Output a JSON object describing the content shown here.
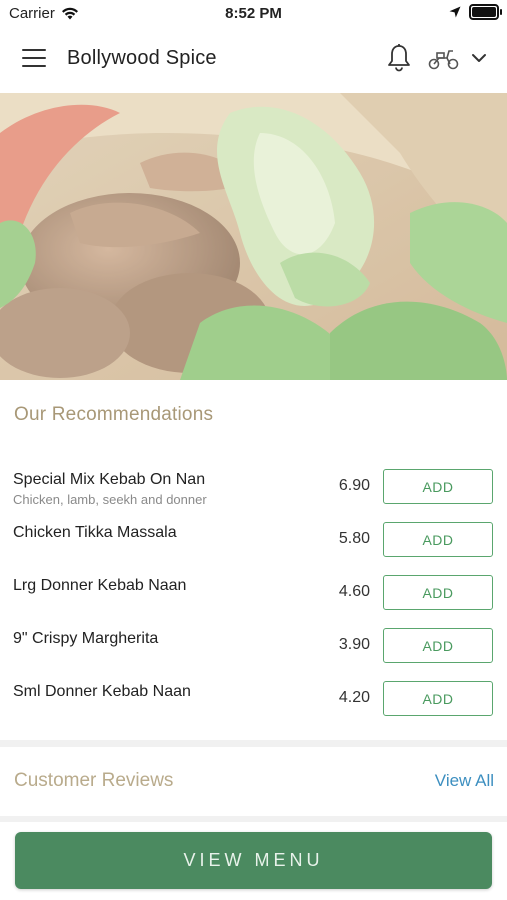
{
  "status_bar": {
    "carrier": "Carrier",
    "time": "8:52 PM"
  },
  "header": {
    "title": "Bollywood Spice"
  },
  "recommendations": {
    "title": "Our Recommendations",
    "items": [
      {
        "name": "Special Mix Kebab On Nan",
        "description": "Chicken, lamb, seekh and donner",
        "price": "6.90",
        "button": "ADD"
      },
      {
        "name": "Chicken Tikka Massala",
        "description": "",
        "price": "5.80",
        "button": "ADD"
      },
      {
        "name": "Lrg Donner Kebab Naan",
        "description": "",
        "price": "4.60",
        "button": "ADD"
      },
      {
        "name": "9\" Crispy Margherita",
        "description": "",
        "price": "3.90",
        "button": "ADD"
      },
      {
        "name": "Sml Donner Kebab Naan",
        "description": "",
        "price": "4.20",
        "button": "ADD"
      }
    ]
  },
  "reviews": {
    "title": "Customer Reviews",
    "view_all": "View All"
  },
  "footer": {
    "view_menu": "VIEW MENU"
  },
  "colors": {
    "accent_green": "#4b8a60",
    "section_title": "#a89877",
    "link_blue": "#3d8fc0"
  },
  "icons": [
    "wifi-icon",
    "location-arrow-icon",
    "battery-icon",
    "hamburger-menu-icon",
    "bell-icon",
    "scooter-icon",
    "chevron-down-icon"
  ]
}
